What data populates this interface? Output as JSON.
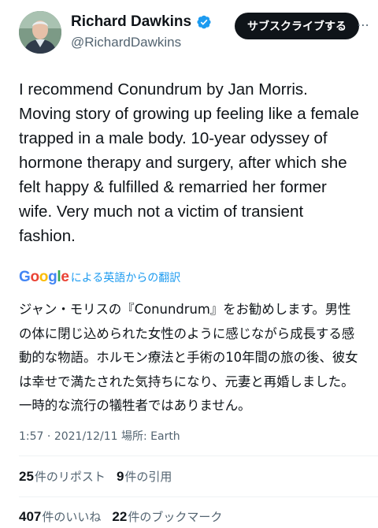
{
  "author": {
    "display_name": "Richard Dawkins",
    "handle": "@RichardDawkins",
    "avatar_icon": "profile-photo",
    "verified_icon": "verified-badge-icon"
  },
  "subscribe_label": "サブスクライブする",
  "tweet": {
    "text": "I recommend Conundrum by Jan Morris. Moving story of growing up feeling like a female trapped in a male body. 10-year odyssey of hormone therapy and surgery, after which she felt happy & fulfilled & remarried her former wife. Very much not a victim of transient fashion."
  },
  "translation": {
    "provider": "Google",
    "label": "による英語からの翻訳",
    "text": "ジャン・モリスの『Conundrum』をお勧めします。男性の体に閉じ込められた女性のように感じながら成長する感動的な物語。ホルモン療法と手術の10年間の旅の後、彼女は幸せで満たされた気持ちになり、元妻と再婚しました。一時的な流行の犠牲者ではありません。"
  },
  "meta": {
    "time": "1:57",
    "date": "2021/12/11",
    "location_label": "場所:",
    "location": "Earth"
  },
  "stats": {
    "reposts": "25",
    "reposts_label": "件のリポスト",
    "quotes": "9",
    "quotes_label": "件の引用",
    "likes": "407",
    "likes_label": "件のいいね",
    "bookmarks": "22",
    "bookmarks_label": "件のブックマーク"
  },
  "colors": {
    "text": "#0f1419",
    "secondary": "#536471",
    "link": "#1d9bf0",
    "button_bg": "#0f1419"
  }
}
